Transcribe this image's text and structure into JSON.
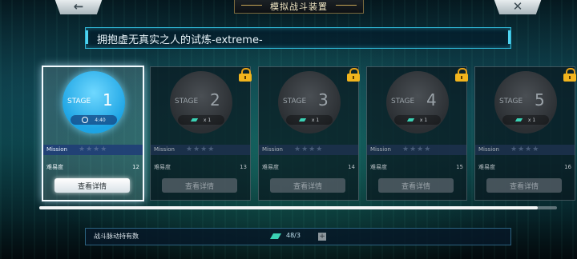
{
  "header": {
    "back_icon": "←",
    "title": "模拟战斗装置",
    "close_icon": "✕"
  },
  "stage_header": {
    "title": "拥抱虚无真实之人的试炼-extreme-"
  },
  "cards": [
    {
      "stage_word": "STAGE",
      "number": "1",
      "cost": "4:40",
      "mission": "Mission",
      "difficulty_label": "难易度",
      "difficulty": "12",
      "detail": "查看详情",
      "locked": false,
      "active": true
    },
    {
      "stage_word": "STAGE",
      "number": "2",
      "cost": "x 1",
      "mission": "Mission",
      "difficulty_label": "难易度",
      "difficulty": "13",
      "detail": "查看详情",
      "locked": true,
      "active": false
    },
    {
      "stage_word": "STAGE",
      "number": "3",
      "cost": "x 1",
      "mission": "Mission",
      "difficulty_label": "难易度",
      "difficulty": "14",
      "detail": "查看详情",
      "locked": true,
      "active": false
    },
    {
      "stage_word": "STAGE",
      "number": "4",
      "cost": "x 1",
      "mission": "Mission",
      "difficulty_label": "难易度",
      "difficulty": "15",
      "detail": "查看详情",
      "locked": true,
      "active": false
    },
    {
      "stage_word": "STAGE",
      "number": "5",
      "cost": "x 1",
      "mission": "Mission",
      "difficulty_label": "难易度",
      "difficulty": "16",
      "detail": "查看详情",
      "locked": true,
      "active": false
    }
  ],
  "footer": {
    "label": "战斗脉动持有数",
    "count": "48/3",
    "plus": "+"
  },
  "scroll_position": 0.96,
  "colors": {
    "accent": "#2fb7d6",
    "active_stage": "#1da4e4",
    "lock": "#f2b51d",
    "pulse_chip": "#3ad1b4"
  }
}
